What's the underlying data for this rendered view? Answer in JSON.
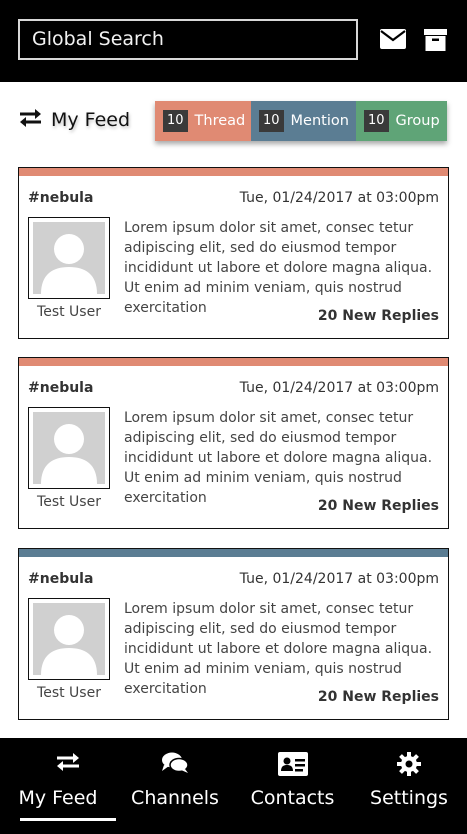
{
  "header": {
    "search_value": "Global Search",
    "icons": [
      "envelope-icon",
      "archive-icon"
    ]
  },
  "feed": {
    "title": "My Feed",
    "filters": [
      {
        "count": "10",
        "label": "Thread",
        "color": "#e08a73"
      },
      {
        "count": "10",
        "label": "Mention",
        "color": "#5b7d93"
      },
      {
        "count": "10",
        "label": "Group",
        "color": "#5fa477"
      }
    ]
  },
  "cards": [
    {
      "strip_color": "#e08a73",
      "channel": "#nebula",
      "date": "Tue, 01/24/2017 at 03:00pm",
      "user": "Test User",
      "message": "Lorem ipsum dolor sit amet, consec tetur adipiscing elit, sed do eiusmod tempor incididunt ut labore et dolore magna aliqua. Ut enim ad minim veniam, quis nostrud exercitation",
      "replies": "20 New Replies"
    },
    {
      "strip_color": "#e08a73",
      "channel": "#nebula",
      "date": "Tue, 01/24/2017 at 03:00pm",
      "user": "Test User",
      "message": "Lorem ipsum dolor sit amet, consec tetur adipiscing elit, sed do eiusmod tempor incididunt ut labore et dolore magna aliqua. Ut enim ad minim veniam, quis nostrud exercitation",
      "replies": "20 New Replies"
    },
    {
      "strip_color": "#5b7d93",
      "channel": "#nebula",
      "date": "Tue, 01/24/2017 at 03:00pm",
      "user": "Test User",
      "message": "Lorem ipsum dolor sit amet, consec tetur adipiscing elit, sed do eiusmod tempor incididunt ut labore et dolore magna aliqua. Ut enim ad minim veniam, quis nostrud exercitation",
      "replies": "20 New Replies"
    }
  ],
  "nav": {
    "items": [
      {
        "label": "My Feed",
        "icon": "exchange-arrows-icon",
        "active": true
      },
      {
        "label": "Channels",
        "icon": "chat-bubbles-icon",
        "active": false
      },
      {
        "label": "Contacts",
        "icon": "contact-card-icon",
        "active": false
      },
      {
        "label": "Settings",
        "icon": "gear-icon",
        "active": false
      }
    ]
  }
}
